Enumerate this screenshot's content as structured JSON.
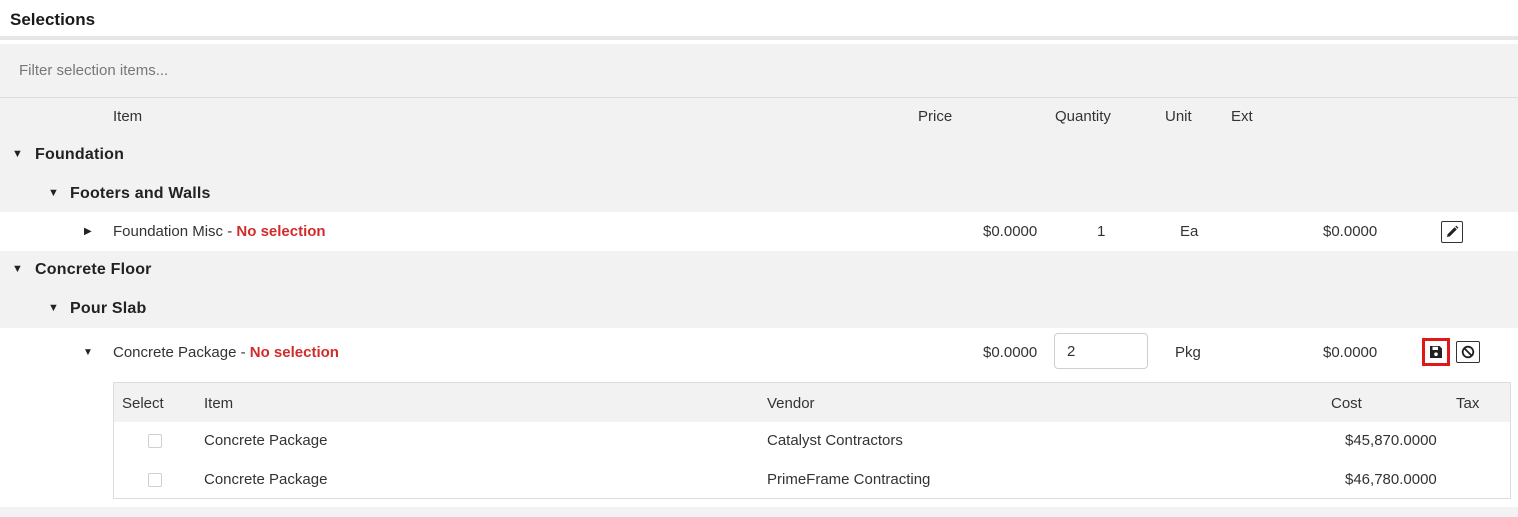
{
  "header": {
    "title": "Selections"
  },
  "filter": {
    "placeholder": "Filter selection items..."
  },
  "columns": {
    "item": "Item",
    "price": "Price",
    "quantity": "Quantity",
    "unit": "Unit",
    "ext": "Ext"
  },
  "groups": [
    {
      "name": "Foundation",
      "subgroups": [
        {
          "name": "Footers and Walls",
          "items": [
            {
              "name": "Foundation Misc",
              "separator": " - ",
              "status": "No selection",
              "price": "$0.0000",
              "quantity": "1",
              "unit": "Ea",
              "ext": "$0.0000",
              "expanded": false
            }
          ]
        }
      ]
    },
    {
      "name": "Concrete Floor",
      "subgroups": [
        {
          "name": "Pour Slab",
          "items": [
            {
              "name": "Concrete Package",
              "separator": " - ",
              "status": "No selection",
              "price": "$0.0000",
              "quantity": "2",
              "unit": "Pkg",
              "ext": "$0.0000",
              "expanded": true,
              "options": {
                "headers": {
                  "select": "Select",
                  "item": "Item",
                  "vendor": "Vendor",
                  "cost": "Cost",
                  "tax": "Tax"
                },
                "rows": [
                  {
                    "item": "Concrete Package",
                    "vendor": "Catalyst Contractors",
                    "cost": "$45,870.0000",
                    "checked": false
                  },
                  {
                    "item": "Concrete Package",
                    "vendor": "PrimeFrame Contracting",
                    "cost": "$46,780.0000",
                    "checked": false
                  }
                ]
              }
            }
          ]
        }
      ]
    }
  ],
  "icons": {
    "edit": "pencil-icon",
    "save": "floppy-disk-icon",
    "cancel": "cancel-circle-icon",
    "expanded": "caret-down-icon",
    "collapsed": "caret-right-icon"
  },
  "colors": {
    "no_selection": "#d22b2b",
    "highlight": "#e01818",
    "row_shade": "#f2f2f2"
  }
}
